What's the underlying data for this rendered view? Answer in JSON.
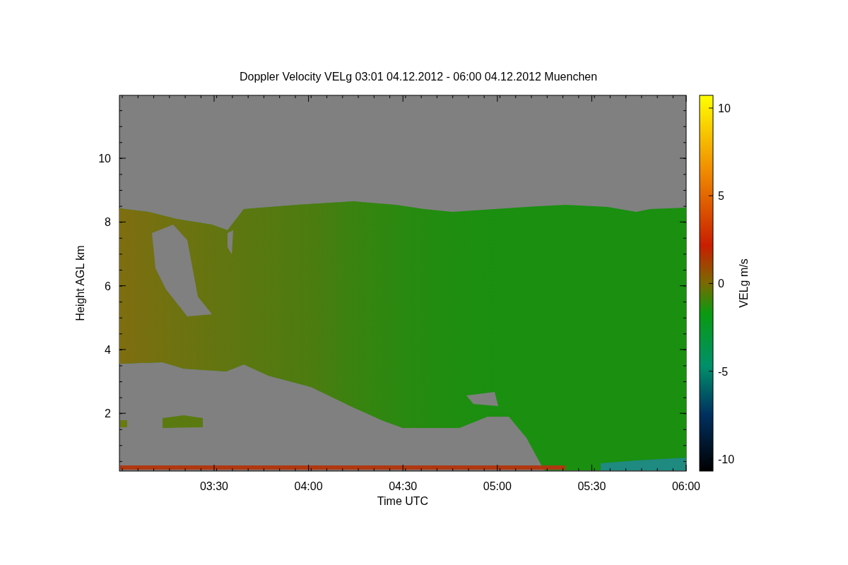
{
  "title": "Doppler Velocity VELg   03:01 04.12.2012 - 06:00 04.12.2012 Muenchen",
  "x_axis": {
    "label": "Time UTC",
    "ticks": [
      "03:30",
      "04:00",
      "04:30",
      "05:00",
      "05:30",
      "06:00"
    ]
  },
  "y_axis": {
    "label": "Height AGL km",
    "ticks": [
      "10",
      "8",
      "6",
      "4",
      "2"
    ]
  },
  "colorbar": {
    "label": "VELg m/s",
    "ticks": [
      "10",
      "5",
      "0",
      "-5",
      "-10"
    ]
  }
}
